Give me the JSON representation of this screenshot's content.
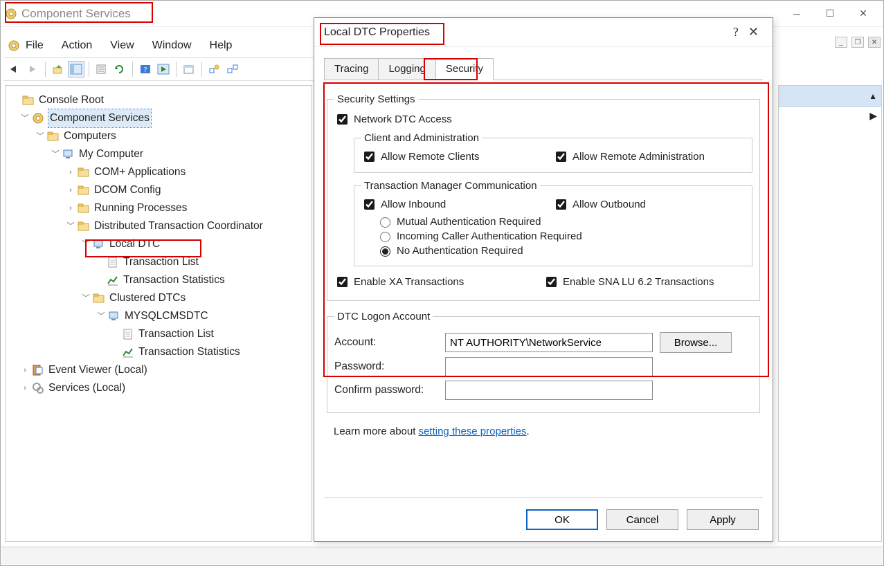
{
  "window": {
    "title": "Component Services"
  },
  "mdi_controls": {
    "min": "_",
    "max": "▭",
    "close": "✕"
  },
  "menubar": [
    "File",
    "Action",
    "View",
    "Window",
    "Help"
  ],
  "toolbar": {
    "items": [
      "back",
      "forward",
      "|",
      "up",
      "show-hide",
      "|",
      "export",
      "refresh",
      "|",
      "help",
      "play",
      "|",
      "app",
      "|",
      "grp1",
      "grp2"
    ]
  },
  "tree": {
    "root": "Console Root",
    "nodes": [
      {
        "label": "Component Services",
        "expanded": true,
        "icon": "gear",
        "selected": true,
        "children": [
          {
            "label": "Computers",
            "expanded": true,
            "icon": "folder",
            "children": [
              {
                "label": "My Computer",
                "expanded": true,
                "icon": "computer",
                "children": [
                  {
                    "label": "COM+ Applications",
                    "icon": "folder",
                    "leaf": true
                  },
                  {
                    "label": "DCOM Config",
                    "icon": "folder",
                    "leaf": true
                  },
                  {
                    "label": "Running Processes",
                    "icon": "folder",
                    "leaf": true
                  },
                  {
                    "label": "Distributed Transaction Coordinator",
                    "expanded": true,
                    "icon": "folder",
                    "children": [
                      {
                        "label": "Local DTC",
                        "expanded": true,
                        "icon": "computer",
                        "highlight": true,
                        "children": [
                          {
                            "label": "Transaction List",
                            "icon": "doc"
                          },
                          {
                            "label": "Transaction Statistics",
                            "icon": "stats"
                          }
                        ]
                      },
                      {
                        "label": "Clustered DTCs",
                        "expanded": true,
                        "icon": "folder",
                        "children": [
                          {
                            "label": "MYSQLCMSDTC",
                            "expanded": true,
                            "icon": "computer",
                            "children": [
                              {
                                "label": "Transaction List",
                                "icon": "doc"
                              },
                              {
                                "label": "Transaction Statistics",
                                "icon": "stats"
                              }
                            ]
                          }
                        ]
                      }
                    ]
                  }
                ]
              }
            ]
          }
        ]
      },
      {
        "label": "Event Viewer (Local)",
        "icon": "eventviewer",
        "leaf": true
      },
      {
        "label": "Services (Local)",
        "icon": "services",
        "leaf": true
      }
    ]
  },
  "dialog": {
    "title": "Local DTC Properties",
    "tabs": [
      "Tracing",
      "Logging",
      "Security"
    ],
    "active_tab": "Security",
    "security": {
      "groupTitle": "Security Settings",
      "networkDtc": {
        "label": "Network DTC Access",
        "checked": true
      },
      "clientAdmin": {
        "title": "Client and Administration",
        "allowRemoteClients": {
          "label": "Allow Remote Clients",
          "checked": true
        },
        "allowRemoteAdmin": {
          "label": "Allow Remote Administration",
          "checked": true
        }
      },
      "tmc": {
        "title": "Transaction Manager Communication",
        "allowInbound": {
          "label": "Allow Inbound",
          "checked": true
        },
        "allowOutbound": {
          "label": "Allow Outbound",
          "checked": true
        },
        "auth": {
          "mutual": "Mutual Authentication Required",
          "incoming": "Incoming Caller Authentication Required",
          "none": "No Authentication Required",
          "selected": "none"
        }
      },
      "enableXA": {
        "label": "Enable XA Transactions",
        "checked": true
      },
      "enableSNA": {
        "label": "Enable SNA LU 6.2 Transactions",
        "checked": true
      },
      "logon": {
        "title": "DTC Logon Account",
        "accountLabel": "Account:",
        "accountValue": "NT AUTHORITY\\NetworkService",
        "browse": "Browse...",
        "passwordLabel": "Password:",
        "confirmLabel": "Confirm password:"
      },
      "learnPrefix": "Learn more about ",
      "learnLink": "setting these properties",
      "learnSuffix": "."
    },
    "buttons": {
      "ok": "OK",
      "cancel": "Cancel",
      "apply": "Apply"
    }
  }
}
